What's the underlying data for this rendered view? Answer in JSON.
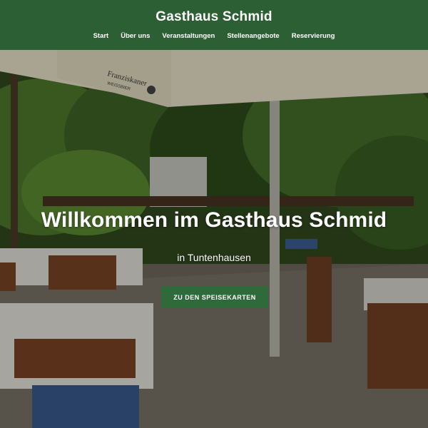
{
  "site": {
    "title": "Gasthaus Schmid"
  },
  "nav": {
    "items": [
      "Start",
      "Über uns",
      "Veranstaltungen",
      "Stellenangebote",
      "Reservierung"
    ]
  },
  "hero": {
    "title": "Willkommen im Gasthaus Schmid",
    "subtitle": "in Tuntenhausen",
    "cta_label": "ZU DEN SPEISEKARTEN",
    "umbrella_print": "Franziskaner",
    "umbrella_print_sub": "WEISSBIER"
  },
  "colors": {
    "header_bg": "#2d5f35",
    "button_bg": "#2e6a3a",
    "text": "#ffffff"
  }
}
